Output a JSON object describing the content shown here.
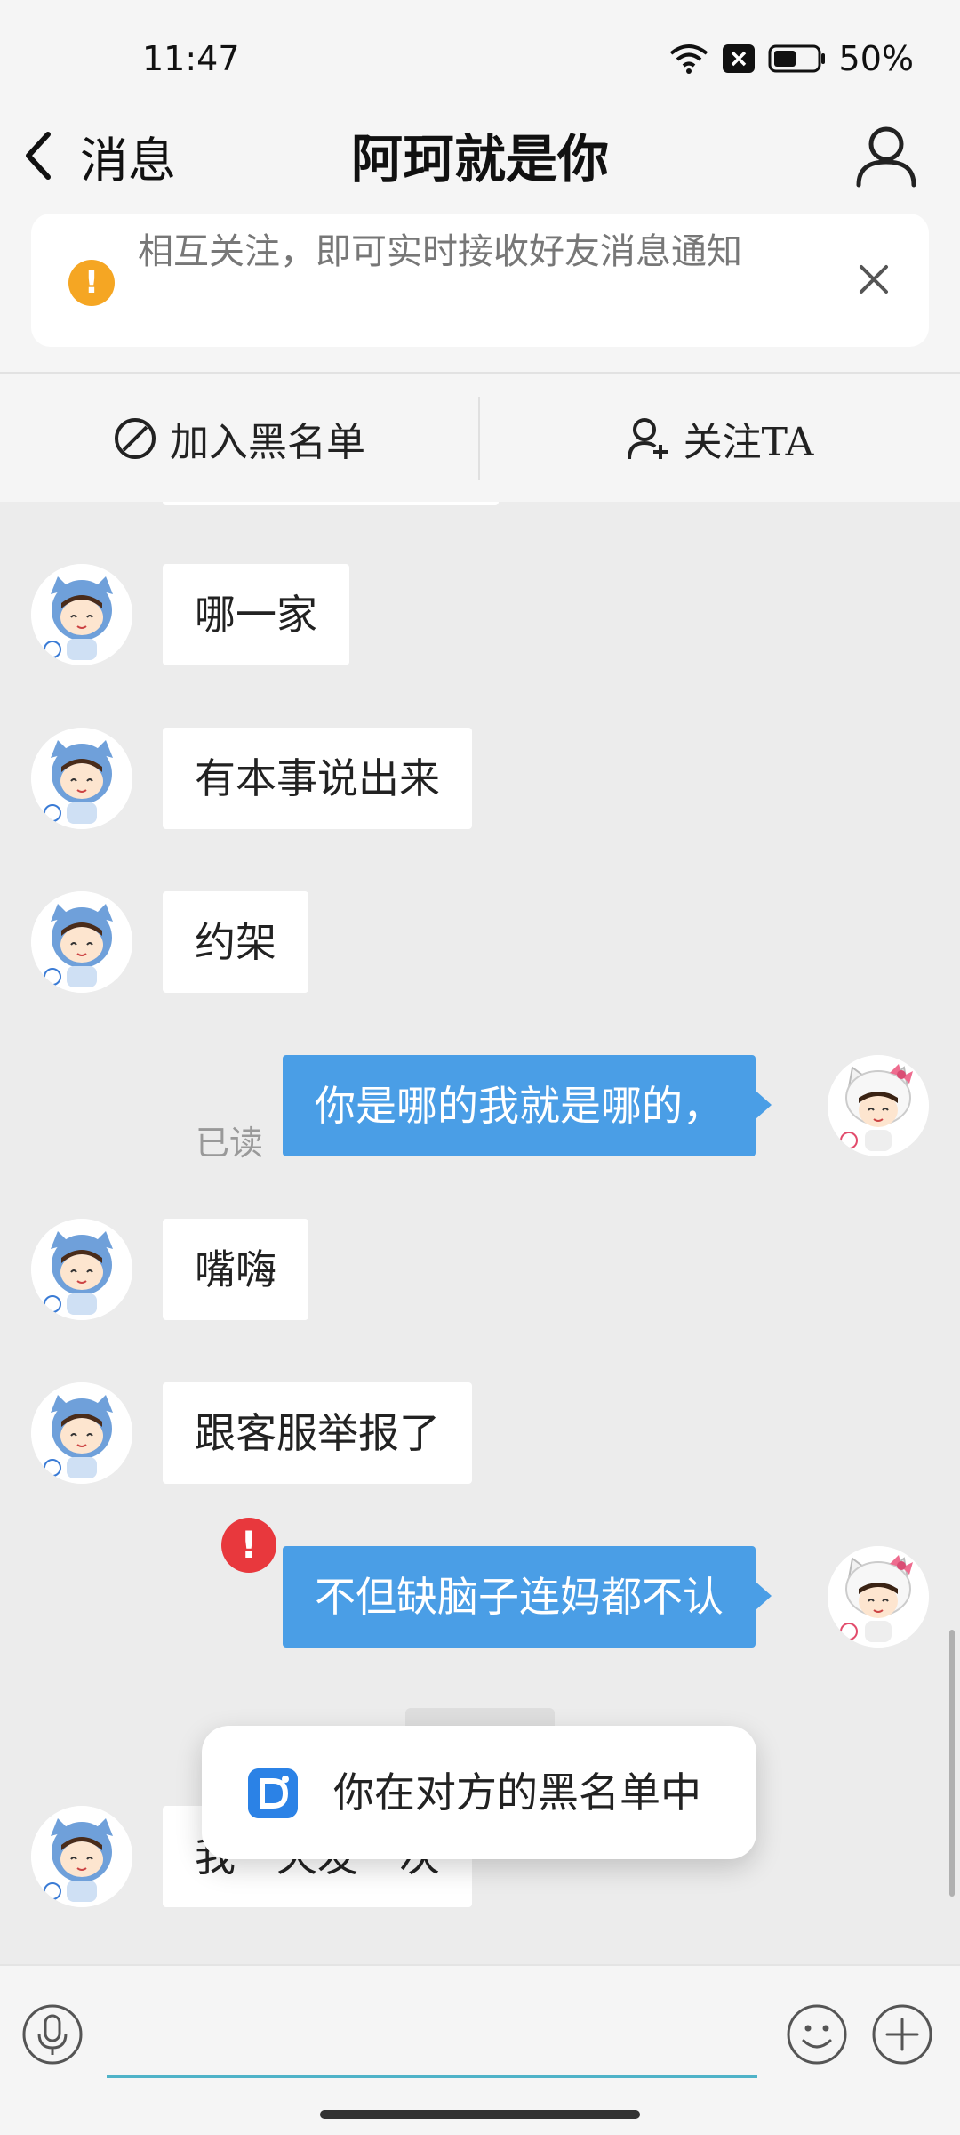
{
  "status_bar": {
    "time": "11:47",
    "battery": "50%"
  },
  "header": {
    "back_label": "消息",
    "title": "阿珂就是你"
  },
  "notice": {
    "text": "相互关注，即可实时接收好友消息通知"
  },
  "actions": {
    "block_label": "加入黑名单",
    "follow_label": "关注TA"
  },
  "messages": [
    {
      "from": "other",
      "text": "哪一家"
    },
    {
      "from": "other",
      "text": "有本事说出来"
    },
    {
      "from": "other",
      "text": "约架"
    },
    {
      "from": "me",
      "text": "你是哪的我就是哪的，",
      "status": "已读"
    },
    {
      "from": "other",
      "text": "嘴嗨"
    },
    {
      "from": "other",
      "text": "跟客服举报了"
    },
    {
      "from": "me",
      "text": "不但缺脑子连妈都不认",
      "status": "failed"
    },
    {
      "from": "other",
      "text": "我一天发一次"
    }
  ],
  "toast": {
    "text": "你在对方的黑名单中"
  },
  "input": {
    "placeholder": ""
  },
  "colors": {
    "my_bubble": "#4a9ee6",
    "error": "#e8383d",
    "warning": "#f5a623",
    "input_underline": "#4fb3c8"
  }
}
